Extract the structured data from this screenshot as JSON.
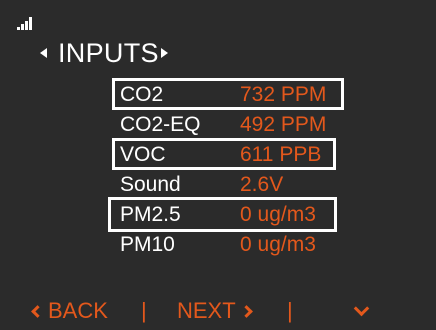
{
  "status": {
    "signal_icon": "signal-bars-icon"
  },
  "header": {
    "title": "INPUTS"
  },
  "readings": [
    {
      "label": "CO2",
      "value": "732 PPM",
      "highlighted": true
    },
    {
      "label": "CO2-EQ",
      "value": "492 PPM",
      "highlighted": false
    },
    {
      "label": "VOC",
      "value": "611 PPB",
      "highlighted": true
    },
    {
      "label": "Sound",
      "value": "2.6V",
      "highlighted": false
    },
    {
      "label": "PM2.5",
      "value": "0 ug/m3",
      "highlighted": true
    },
    {
      "label": "PM10",
      "value": "0 ug/m3",
      "highlighted": false
    }
  ],
  "footer": {
    "back_label": "BACK",
    "next_label": "NEXT",
    "separator": "|"
  },
  "colors": {
    "background": "#2b2b2b",
    "text": "#ffffff",
    "accent": "#e3581c"
  }
}
